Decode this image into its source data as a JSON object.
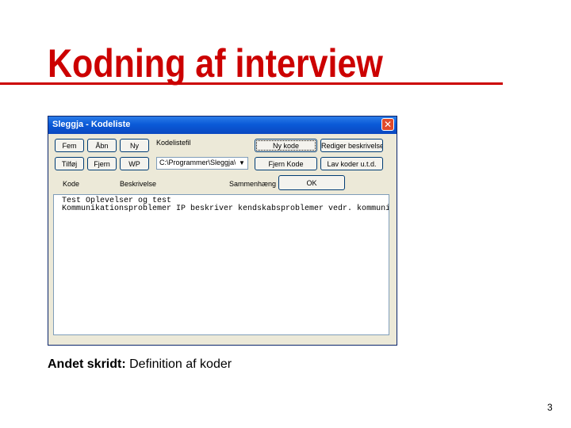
{
  "slide": {
    "title": "Kodning af interview",
    "caption_bold": "Andet skridt:",
    "caption_text": " Definition af koder",
    "page_number": "3"
  },
  "window": {
    "title": "Sleggja - Kodeliste",
    "close_glyph": "✕",
    "buttons": {
      "fem": "Fem",
      "abn": "Åbn",
      "ny": "Ny",
      "tilfoj": "Tilføj",
      "fjern": "Fjern",
      "wp": "WP",
      "ny_kode": "Ny kode",
      "rediger": "Rediger beskrivelse",
      "fjern_kode": "Fjern Kode",
      "lav_koder": "Lav koder u.t.d.",
      "ok": "OK"
    },
    "labels": {
      "kodelistefil": "Kodelistefil",
      "kode": "Kode",
      "beskrivelse": "Beskrivelse",
      "sammenhaeng": "Sammenhæng"
    },
    "combo_value": "C:\\Programmer\\Sleggja\\CB",
    "combo_arrow": "▼",
    "list_rows": [
      "Test          Oplevelser og test",
      "Kommunikationsproblemer IP beskriver kendskabsproblemer vedr. kommunikation"
    ]
  },
  "colors": {
    "title_red": "#cc0000",
    "titlebar_blue": "#0a5ad8",
    "window_bg": "#ece9d8"
  }
}
